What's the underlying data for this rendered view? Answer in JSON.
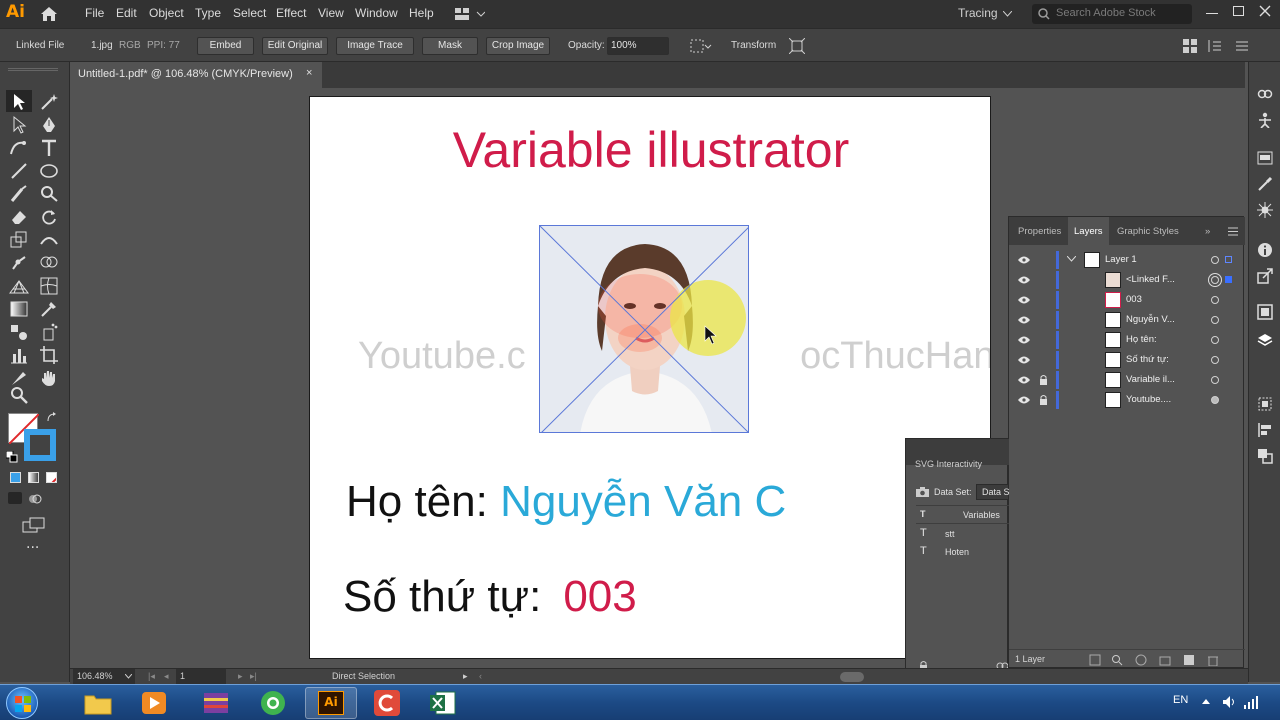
{
  "app": {
    "logo": "Ai"
  },
  "menu": [
    "File",
    "Edit",
    "Object",
    "Type",
    "Select",
    "Effect",
    "View",
    "Window",
    "Help"
  ],
  "workspace": "Tracing",
  "search": {
    "placeholder": "Search Adobe Stock"
  },
  "control_bar": {
    "linked_file": "Linked File",
    "file_name": "1.jpg",
    "color_mode": "RGB",
    "ppi": "PPI: 77",
    "embed": "Embed",
    "edit_original": "Edit Original",
    "image_trace": "Image Trace",
    "mask": "Mask",
    "crop_image": "Crop Image",
    "opacity_label": "Opacity:",
    "opacity_value": "100%",
    "transform": "Transform"
  },
  "document_tab": {
    "title": "Untitled-1.pdf* @ 106.48% (CMYK/Preview)",
    "close": "×"
  },
  "artboard": {
    "title": "Variable illustrator",
    "watermark": "Youtube.c                          ocThucHanh",
    "name_label": "Họ tên: ",
    "name_value": "Nguyễn Văn C",
    "stt_label": "Số thứ tự:",
    "stt_value": "003"
  },
  "layers_panel": {
    "tabs": [
      "Properties",
      "Layers",
      "Graphic Styles"
    ],
    "active_tab": "Layers",
    "rows": [
      {
        "name": "Layer 1",
        "locked": false
      },
      {
        "name": "<Linked F...",
        "locked": false
      },
      {
        "name": "003",
        "locked": false
      },
      {
        "name": "Nguyễn V...",
        "locked": false
      },
      {
        "name": "Họ tên:",
        "locked": false
      },
      {
        "name": "Số thứ tự:",
        "locked": false
      },
      {
        "name": "Variable il...",
        "locked": true
      },
      {
        "name": "Youtube....",
        "locked": true
      }
    ],
    "footer_count": "1 Layer"
  },
  "svg_panel": {
    "title": "SVG Interactivity",
    "dataset_label": "Data Set:",
    "dataset_value": "Data S",
    "variables_header": "Variables",
    "variables": [
      "stt",
      "Hoten"
    ]
  },
  "status_bar": {
    "zoom": "106.48%",
    "artboard_num": "1",
    "tool": "Direct Selection"
  },
  "taskbar": {
    "language": "EN"
  },
  "colors": {
    "accent_red": "#d01c4a",
    "accent_blue": "#2aa9d8",
    "ui_dark": "#323232",
    "ui_panel": "#535353"
  }
}
